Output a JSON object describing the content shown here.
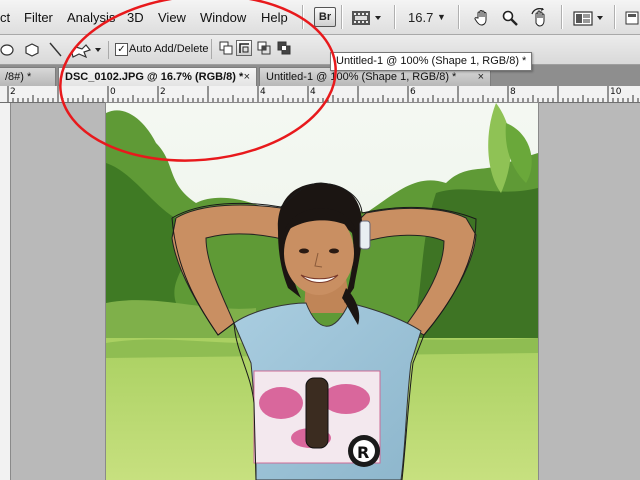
{
  "menubar": {
    "items": [
      {
        "label": "ct"
      },
      {
        "label": "Filter"
      },
      {
        "label": "Analysis"
      },
      {
        "label": "3D"
      },
      {
        "label": "View"
      },
      {
        "label": "Window"
      },
      {
        "label": "Help"
      }
    ],
    "bridge_label": "Br",
    "zoom": "16.7",
    "icons": [
      "arrange-documents-icon",
      "hand-tool-icon",
      "zoom-tool-icon",
      "rotate-view-icon",
      "screen-mode-icon"
    ]
  },
  "options": {
    "auto_add_delete_label": "Auto Add/Delete",
    "auto_add_delete_checked": true,
    "tooltip": "Untitled-1 @ 100% (Shape 1, RGB/8) *"
  },
  "tabs": [
    {
      "label": "/8#) *",
      "close": ""
    },
    {
      "label": "DSC_0102.JPG @ 16.7% (RGB/8) *",
      "close": "×"
    },
    {
      "label": "Untitled-1 @ 100% (Shape 1, RGB/8) *",
      "close": "×"
    }
  ],
  "ruler": {
    "labels": [
      "2",
      "0",
      "2",
      "4",
      "6",
      "8",
      "10"
    ]
  },
  "annotation": {
    "color": "#e8191c"
  },
  "colors": {
    "menubar": "#e6e6e6",
    "workspace": "#b9b9b9",
    "tab_active": "#f0f0f0",
    "annotation": "#e8191c"
  }
}
